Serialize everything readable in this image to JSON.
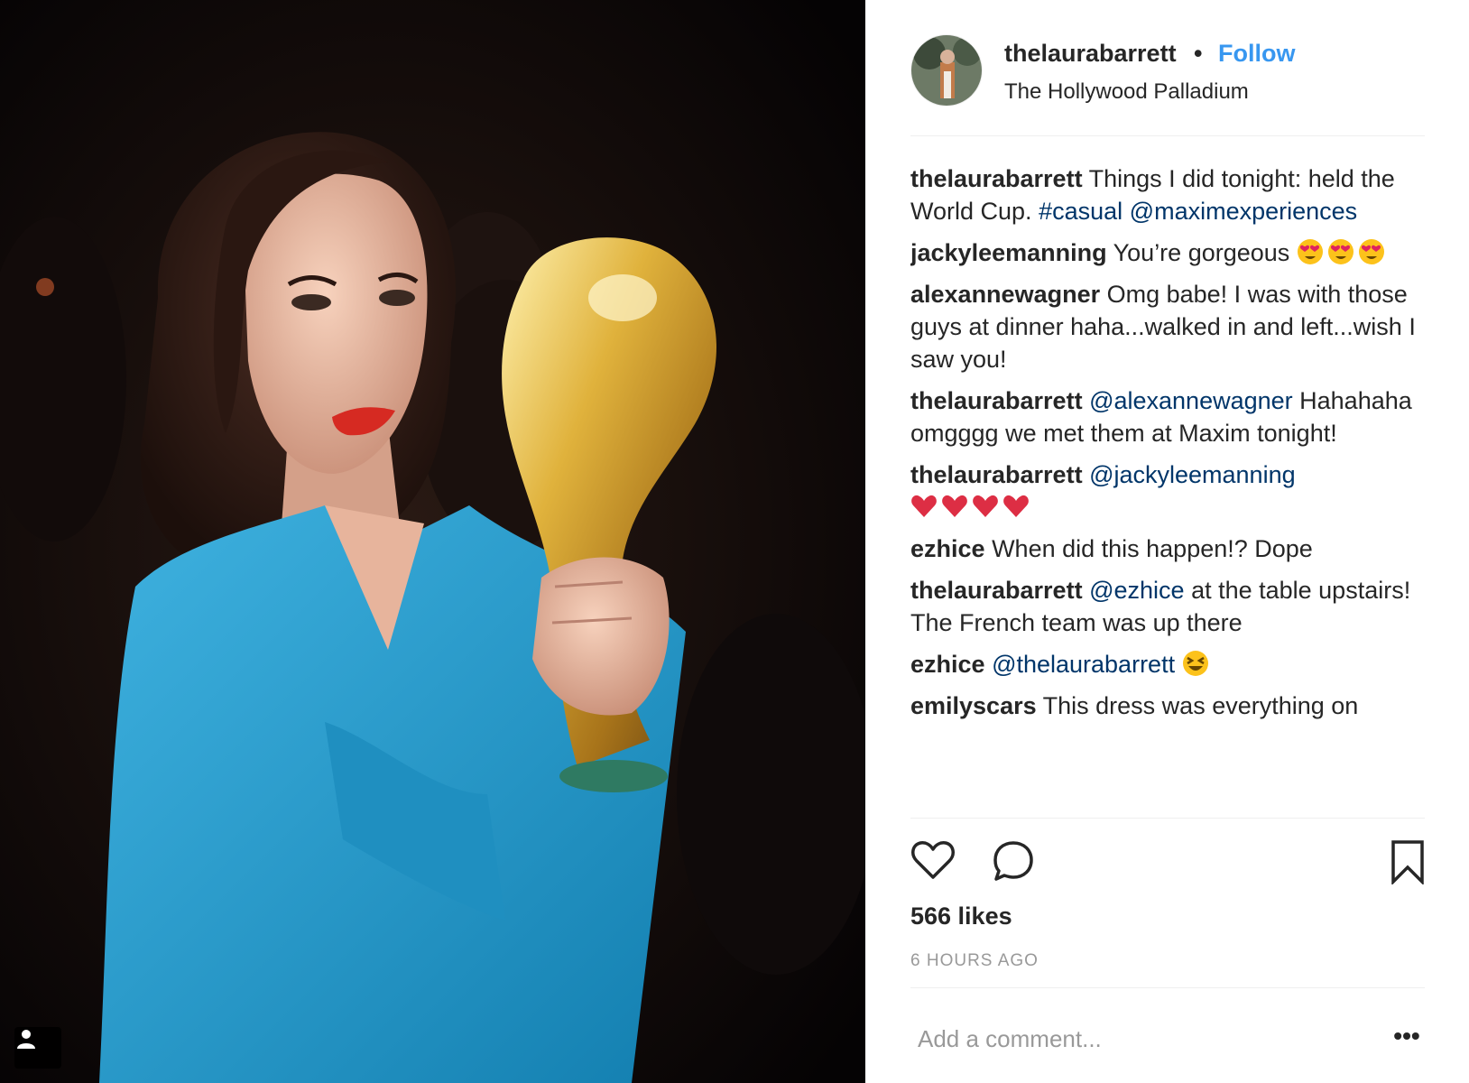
{
  "post": {
    "username": "thelaurabarrett",
    "separator": "•",
    "follow_label": "Follow",
    "location": "The Hollywood Palladium",
    "likes": "566 likes",
    "timestamp": "6 HOURS AGO",
    "comment_placeholder": "Add a comment...",
    "more_label": "•••"
  },
  "caption": {
    "user": "thelaurabarrett",
    "text": "Things I did tonight: held the World Cup.",
    "hashtag": "#casual",
    "mention": "@maximexperiences"
  },
  "comments": [
    {
      "user": "jackyleemanning",
      "text": "You’re gorgeous",
      "emojis": [
        "heart-eyes-emoji",
        "heart-eyes-emoji",
        "heart-eyes-emoji"
      ]
    },
    {
      "user": "alexannewagner",
      "text": "Omg babe! I was with those guys at dinner haha...walked in and left...wish I saw you!"
    },
    {
      "user": "thelaurabarrett",
      "mention": "@alexannewagner",
      "text": "Hahahaha omgggg we met them at Maxim tonight!"
    },
    {
      "user": "thelaurabarrett",
      "mention": "@jackyleemanning",
      "emojis": [
        "red-heart-emoji",
        "red-heart-emoji",
        "red-heart-emoji",
        "red-heart-emoji"
      ]
    },
    {
      "user": "ezhice",
      "text": "When did this happen!? Dope"
    },
    {
      "user": "thelaurabarrett",
      "mention": "@ezhice",
      "text": "at the table upstairs! The French team was up there"
    },
    {
      "user": "ezhice",
      "mention": "@thelaurabarrett",
      "emojis": [
        "laughing-emoji"
      ]
    },
    {
      "user": "emilyscars",
      "text": "This dress was everything on"
    }
  ],
  "colors": {
    "link_blue": "#3897f0",
    "mention_blue": "#003569",
    "text": "#262626",
    "muted": "#999999",
    "divider": "#efefef"
  },
  "icons": {
    "like": "heart-icon",
    "comment": "comment-bubble-icon",
    "save": "bookmark-icon",
    "tag": "user-tag-icon"
  }
}
